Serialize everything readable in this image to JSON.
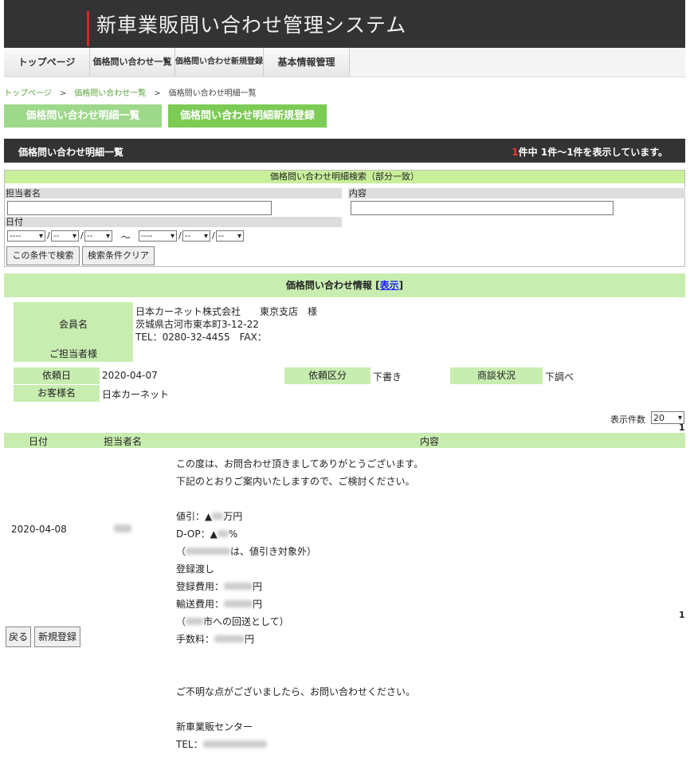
{
  "header": {
    "title": "新車業販問い合わせ管理システム"
  },
  "nav": {
    "items": [
      "トップページ",
      "価格問い合わせ一覧",
      "価格問い合わせ新規登録",
      "基本情報管理"
    ]
  },
  "breadcrumb": {
    "home": "トップページ",
    "list": "価格問い合わせ一覧",
    "current": "価格問い合わせ明細一覧",
    "sep": ">"
  },
  "actions": {
    "list_button": "価格問い合わせ明細一覧",
    "new_button": "価格問い合わせ明細新規登録"
  },
  "section": {
    "title": "価格問い合わせ明細一覧",
    "count": "1",
    "count_suffix": "件中 1件～1件を表示しています。"
  },
  "search": {
    "header": "価格問い合わせ明細検索（部分一致）",
    "staff_label": "担当者名",
    "content_label": "内容",
    "date_label": "日付",
    "year_placeholder": "----",
    "md_placeholder": "--",
    "slash": "/",
    "tilde": "～",
    "search_button": "この条件で検索",
    "clear_button": "検索条件クリア"
  },
  "info": {
    "header": "価格問い合わせ情報",
    "toggle_open": "[",
    "toggle": "表示",
    "toggle_close": "]",
    "member_label": "会員名",
    "staff_label": "ご担当者様",
    "member_name": "日本カーネット株式会社　　東京支店　様",
    "address": "茨城県古河市東本町3-12-22",
    "tel": "TEL：0280-32-4455　FAX：",
    "request_date_label": "依頼日",
    "request_date": "2020-04-07",
    "request_type_label": "依頼区分",
    "request_type": "下書き",
    "status_label": "商談状況",
    "status": "下調べ",
    "customer_label": "お客様名",
    "customer": "日本カーネット"
  },
  "pager": {
    "label": "表示件数",
    "value": "20",
    "page": "1",
    "page_bottom": "1"
  },
  "list": {
    "headers": [
      "日付",
      "担当者名",
      "内容"
    ],
    "row": {
      "date": "2020-04-08",
      "staff": "",
      "lines": {
        "l1": "この度は、お問合わせ頂きましてありがとうございます。",
        "l2": "下記のとおりご案内いたしますので、ご検討ください。",
        "l3a": "値引：▲",
        "l3b": "万円",
        "l4a": "D-OP：▲",
        "l4b": "%",
        "l5a": "（",
        "l5b": "は、値引き対象外）",
        "l6": "登録渡し",
        "l7a": "登録費用：",
        "l7b": "円",
        "l8a": "輸送費用：",
        "l8b": "円",
        "l9a": "（",
        "l9b": "市への回送として）",
        "l10a": "手数料：",
        "l10b": "円",
        "l11": "ご不明な点がございましたら、お問い合わせください。",
        "l12": "新車業販センター",
        "l13": "TEL："
      }
    }
  },
  "footer": {
    "back": "戻る",
    "new": "新規登録"
  },
  "colors": {
    "header_bg": "#333333",
    "accent_red": "#d8262b",
    "green_button": "#8fd56b",
    "green_light": "#c8edb0",
    "search_header": "#c8f09a"
  }
}
